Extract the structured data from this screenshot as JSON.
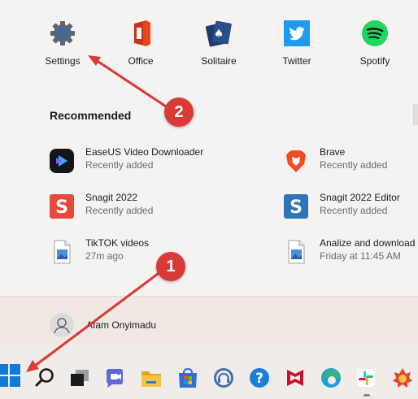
{
  "pinned": [
    {
      "label": "Settings",
      "icon": "settings-gear-icon"
    },
    {
      "label": "Office",
      "icon": "office-icon"
    },
    {
      "label": "Solitaire",
      "icon": "solitaire-icon"
    },
    {
      "label": "Twitter",
      "icon": "twitter-icon"
    },
    {
      "label": "Spotify",
      "icon": "spotify-icon"
    }
  ],
  "recommended": {
    "heading": "Recommended",
    "items": [
      {
        "name": "EaseUS Video Downloader",
        "sub": "Recently added",
        "icon": "easeus-icon"
      },
      {
        "name": "Brave",
        "sub": "Recently added",
        "icon": "brave-icon"
      },
      {
        "name": "Snagit 2022",
        "sub": "Recently added",
        "icon": "snagit-icon"
      },
      {
        "name": "Snagit 2022 Editor",
        "sub": "Recently added",
        "icon": "snagit-editor-icon"
      },
      {
        "name": "TikTOK videos",
        "sub": "27m ago",
        "icon": "image-file-icon"
      },
      {
        "name": "Analize and download",
        "sub": "Friday at 11:45 AM",
        "icon": "image-file-icon"
      }
    ]
  },
  "user": {
    "name": "Afam Onyimadu"
  },
  "taskbar": [
    {
      "name": "start-button",
      "icon": "windows-logo-icon"
    },
    {
      "name": "search-button",
      "icon": "search-icon"
    },
    {
      "name": "task-view-button",
      "icon": "task-view-icon"
    },
    {
      "name": "teams-chat-button",
      "icon": "chat-icon"
    },
    {
      "name": "file-explorer-button",
      "icon": "folder-icon"
    },
    {
      "name": "microsoft-store-button",
      "icon": "store-icon"
    },
    {
      "name": "app-button",
      "icon": "headset-icon"
    },
    {
      "name": "help-button",
      "icon": "help-icon"
    },
    {
      "name": "mcafee-button",
      "icon": "mcafee-icon"
    },
    {
      "name": "edge-button",
      "icon": "edge-icon"
    },
    {
      "name": "slack-button",
      "icon": "slack-icon"
    },
    {
      "name": "game-button",
      "icon": "game-icon"
    }
  ],
  "annotations": [
    {
      "number": "1",
      "color": "#d93a35"
    },
    {
      "number": "2",
      "color": "#d93a35"
    }
  ],
  "colors": {
    "panel_bg": "#f5f3f2",
    "taskbar_bg": "#f0ecea",
    "annotation_red": "#d93a35",
    "windows_blue": "#0078d4"
  }
}
